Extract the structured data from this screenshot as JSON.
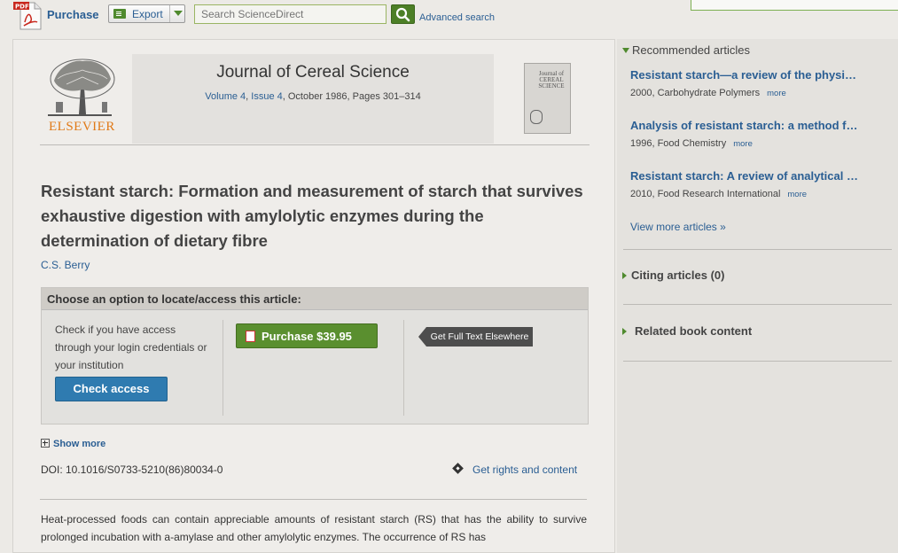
{
  "toolbar": {
    "purchase_label": "Purchase",
    "export_label": "Export",
    "search_placeholder": "Search ScienceDirect",
    "advanced_search": "Advanced search"
  },
  "journal": {
    "publisher": "ELSEVIER",
    "title": "Journal of Cereal Science",
    "volume": "Volume 4",
    "issue": "Issue 4",
    "date_pages": ", October 1986, Pages 301–314",
    "cover_text": "Journal of CEREAL SCIENCE"
  },
  "article": {
    "title": "Resistant starch: Formation and measurement of starch that survives exhaustive digestion with amylolytic enzymes during the determination of dietary fibre",
    "author": "C.S. Berry",
    "doi": "DOI: 10.1016/S0733-5210(86)80034-0",
    "rights_label": "Get rights and content",
    "show_more": "Show more",
    "abstract": "Heat-processed foods can contain appreciable amounts of resistant starch (RS) that has the ability to survive prolonged incubation with a-amylase and other amylolytic enzymes. The occurrence of RS has"
  },
  "access": {
    "heading": "Choose an option to locate/access this article:",
    "check_text": "Check if you have access through your login credentials or your institution",
    "check_button": "Check access",
    "purchase_button": "Purchase $39.95",
    "fulltext_button": "Get Full Text Elsewhere"
  },
  "sidebar": {
    "recommended_heading": "Recommended articles",
    "recommended": [
      {
        "title": "Resistant starch—a review of the physi…",
        "meta": "2000, Carbohydrate Polymers",
        "more": "more"
      },
      {
        "title": "Analysis of resistant starch: a method f…",
        "meta": "1996, Food Chemistry",
        "more": "more"
      },
      {
        "title": "Resistant starch: A review of analytical …",
        "meta": "2010, Food Research International",
        "more": "more"
      }
    ],
    "view_more": "View more articles »",
    "citing_heading": "Citing articles (0)",
    "related_heading": "Related book content"
  },
  "colors": {
    "link": "#2a5e93",
    "green_button": "#5a8f2f",
    "blue_button": "#2f7bb0",
    "elsevier_orange": "#e07a18"
  }
}
